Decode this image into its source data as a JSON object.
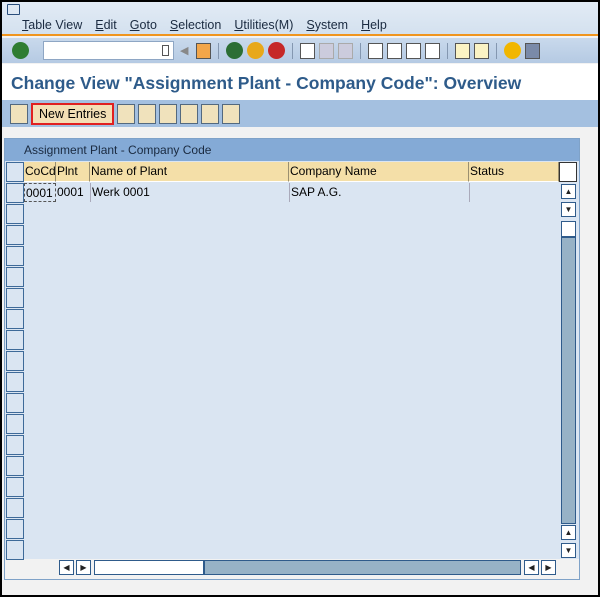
{
  "menu": [
    "Table View",
    "Edit",
    "Goto",
    "Selection",
    "Utilities(M)",
    "System",
    "Help"
  ],
  "title": "Change View \"Assignment Plant - Company Code\": Overview",
  "app_toolbar": {
    "new_entries": "New Entries"
  },
  "panel": {
    "title": "Assignment Plant - Company Code",
    "columns": [
      "CoCd",
      "Plnt",
      "Name of Plant",
      "Company Name",
      "Status"
    ],
    "rows": [
      {
        "cocd": "0001",
        "plnt": "0001",
        "name": "Werk 0001",
        "company": "SAP A.G.",
        "status": ""
      }
    ]
  },
  "colors": {
    "accent": "#f0951e",
    "title": "#2e5b8a",
    "header": "#f4dfa8",
    "new_entries_highlight": "#e02020"
  }
}
